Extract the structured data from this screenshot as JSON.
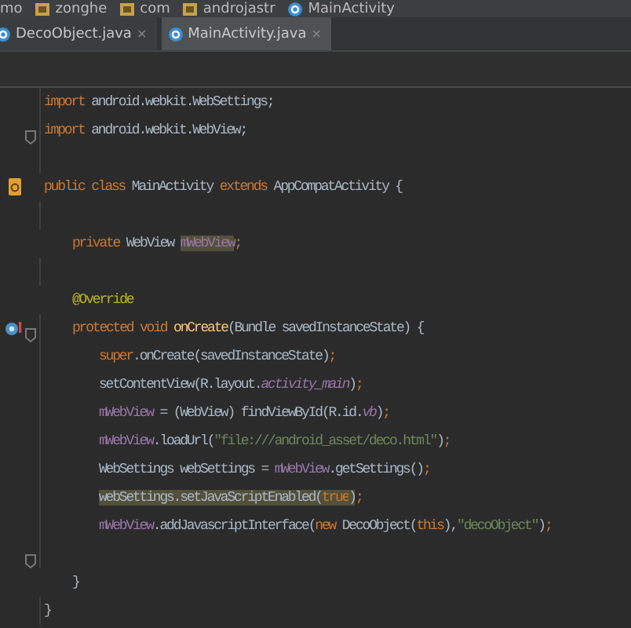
{
  "breadcrumbs": [
    {
      "label": "mo",
      "kind": "text"
    },
    {
      "label": "zonghe",
      "kind": "folder"
    },
    {
      "label": "com",
      "kind": "folder"
    },
    {
      "label": "androjastr",
      "kind": "folder"
    },
    {
      "label": "MainActivity",
      "kind": "class"
    }
  ],
  "tabs": [
    {
      "label": "DecoObject.java",
      "close": "×",
      "selected": false
    },
    {
      "label": "MainActivity.java",
      "close": "×",
      "selected": true
    }
  ],
  "lines": [
    {
      "kind": "top",
      "tokens": [
        {
          "kind": "keyword",
          "text": "import "
        },
        {
          "kind": "plain",
          "text": "android.webkit.WebSettings;"
        }
      ]
    },
    {
      "kind": "top",
      "fold": true,
      "tokens": [
        {
          "kind": "keyword",
          "text": "import "
        },
        {
          "kind": "plain",
          "text": "android.webkit.WebView;"
        }
      ]
    },
    {
      "kind": "top",
      "space_before": true,
      "class_marker": true,
      "tokens": [
        {
          "kind": "keyword",
          "text": "public class "
        },
        {
          "kind": "plain",
          "text": "MainActivity "
        },
        {
          "kind": "keyword",
          "text": "extends "
        },
        {
          "kind": "plain",
          "text": "AppCompatActivity {"
        }
      ]
    },
    {
      "kind": "member",
      "space_before": true,
      "tokens": [
        {
          "kind": "keyword",
          "text": "private "
        },
        {
          "kind": "plain",
          "text": "WebView "
        },
        {
          "kind": "field",
          "text": "mWebView",
          "marked": true
        },
        {
          "kind": "keyword",
          "text": ";"
        }
      ]
    },
    {
      "kind": "member",
      "space_before": true,
      "tokens": [
        {
          "kind": "annotation",
          "text": "@Override"
        }
      ]
    },
    {
      "kind": "member",
      "override_marker": true,
      "fold": true,
      "tokens": [
        {
          "kind": "keyword",
          "text": "protected void "
        },
        {
          "kind": "method",
          "text": "onCreate"
        },
        {
          "kind": "plain",
          "text": "(Bundle savedInstanceState) {"
        }
      ]
    },
    {
      "kind": "body",
      "tokens": [
        {
          "kind": "keyword",
          "text": "super"
        },
        {
          "kind": "plain",
          "text": ".onCreate(savedInstanceState)"
        },
        {
          "kind": "keyword",
          "text": ";"
        }
      ]
    },
    {
      "kind": "body",
      "tokens": [
        {
          "kind": "plain",
          "text": "setContentView(R.layout."
        },
        {
          "kind": "constant",
          "text": "activity_main"
        },
        {
          "kind": "plain",
          "text": ")"
        },
        {
          "kind": "keyword",
          "text": ";"
        }
      ]
    },
    {
      "kind": "body",
      "tokens": [
        {
          "kind": "field",
          "text": "mWebView"
        },
        {
          "kind": "plain",
          "text": " = (WebView) findViewById(R.id."
        },
        {
          "kind": "constant",
          "text": "vb"
        },
        {
          "kind": "plain",
          "text": ")"
        },
        {
          "kind": "keyword",
          "text": ";"
        }
      ]
    },
    {
      "kind": "body",
      "tokens": [
        {
          "kind": "field",
          "text": "mWebView"
        },
        {
          "kind": "plain",
          "text": ".loadUrl("
        },
        {
          "kind": "string",
          "text": "\"file:///android_asset/deco.html\""
        },
        {
          "kind": "plain",
          "text": ")"
        },
        {
          "kind": "keyword",
          "text": ";"
        }
      ]
    },
    {
      "kind": "body",
      "tokens": [
        {
          "kind": "plain",
          "text": "WebSettings webSettings = "
        },
        {
          "kind": "field",
          "text": "mWebView"
        },
        {
          "kind": "plain",
          "text": ".getSettings()"
        },
        {
          "kind": "keyword",
          "text": ";"
        }
      ]
    },
    {
      "kind": "body",
      "tokens": [
        {
          "kind": "plain",
          "text": "webSettings.setJavaScriptEnabled(",
          "marked": true
        },
        {
          "kind": "keyword",
          "text": "true",
          "marked": true
        },
        {
          "kind": "plain",
          "text": ")",
          "marked": true
        },
        {
          "kind": "keyword",
          "text": ";"
        }
      ]
    },
    {
      "kind": "body",
      "tokens": [
        {
          "kind": "field",
          "text": "mWebView"
        },
        {
          "kind": "plain",
          "text": ".addJavascriptInterface("
        },
        {
          "kind": "keyword",
          "text": "new "
        },
        {
          "kind": "plain",
          "text": "DecoObject("
        },
        {
          "kind": "keyword",
          "text": "this"
        },
        {
          "kind": "plain",
          "text": "),"
        },
        {
          "kind": "string",
          "text": "\"decoObject\""
        },
        {
          "kind": "plain",
          "text": ")"
        },
        {
          "kind": "keyword",
          "text": ";"
        }
      ]
    },
    {
      "kind": "member",
      "space_before": true,
      "fold": true,
      "tokens": [
        {
          "kind": "plain",
          "text": "}"
        }
      ]
    },
    {
      "kind": "top",
      "tokens": [
        {
          "kind": "plain",
          "text": "}"
        }
      ]
    }
  ]
}
